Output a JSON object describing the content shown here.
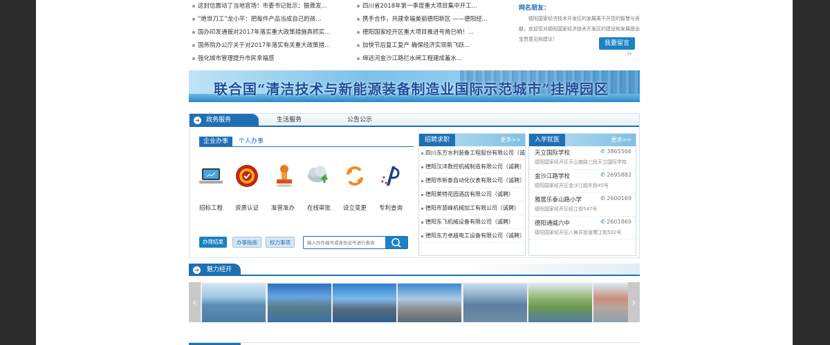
{
  "news_left": [
    "这封信震动了当地官场！市委书记批示：振聋发...",
    "“绝世刀工”龙小平：把每件产品当成自己的孩...",
    "国办印发通报对2017年落实重大政策措施真抓实...",
    "国务院办公厅关于对2017年落实有关重大政策措...",
    "强化城市管理提升市民幸福感"
  ],
  "news_right": [
    "四川省2018年第一季度重大项目集中开工...",
    "携手合作，共建幸福美丽德阳新区 ——德阳经...",
    "德阳国家经开区重大项目推进号角已响！...",
    "加快节后复工复产 确保经济实现新飞跃...",
    "绵远河金沙江路拦水闸工程建成蓄水..."
  ],
  "message": {
    "title": "网名朋友：",
    "text": "德阳国家经济技术开发区的发展离不开您的智慧与贡献，欢迎您对德阳国家经济技术开发区的建设和发展提出宝贵意见和建议！",
    "button": "我要留言"
  },
  "banner": {
    "text": "联合国“清洁技术与新能源装备制造业国际示范城市”挂牌园区"
  },
  "gov": {
    "tabs": [
      "政务服务",
      "生活服务",
      "公告公示"
    ],
    "subtabs": [
      "企业办事",
      "个人办事"
    ],
    "services": [
      {
        "label": "招标工程",
        "icon": "laptop-icon"
      },
      {
        "label": "资质认证",
        "icon": "certificate-seal-icon"
      },
      {
        "label": "准营准办",
        "icon": "stamp-icon"
      },
      {
        "label": "在线审批",
        "icon": "cloud-upload-icon"
      },
      {
        "label": "设立变更",
        "icon": "cycle-arrows-icon"
      },
      {
        "label": "专利查询",
        "icon": "patent-icon"
      }
    ],
    "buttons": [
      "办理结果",
      "办事指南",
      "权力事项"
    ],
    "search_placeholder": "输入办件编号或身份证号进行查询"
  },
  "jobs": {
    "title": "招聘求职",
    "more": "更多>>",
    "items": [
      "四川东方水利装备工程股份有限公司（诚聘）",
      "德阳汉沣数控机械制造有限公司（诚聘）",
      "德阳市新泰自动化仪表有限公司（诚聘）",
      "德阳莱特花园酒店有限公司（诚聘）",
      "德阳市慧峰机械加工有限公司（诚聘）",
      "德阳东飞机械设备有限公司（诚聘）",
      "德阳东方卓越电工设备有限公司（诚聘）"
    ]
  },
  "schools": {
    "title": "入学就医",
    "more": "更多>>",
    "items": [
      {
        "name": "天立国际学校",
        "phone": "3865566",
        "address": "德阳国家经开区天山南路三段天立国际学校"
      },
      {
        "name": "金沙江路学校",
        "phone": "2695882",
        "address": "德阳国家经开区金沙江路东段45号"
      },
      {
        "name": "雅居乐泰山路小学",
        "phone": "2600169",
        "address": "德阳国家经开区经江街547号"
      },
      {
        "name": "德阳通威六中",
        "phone": "2601869",
        "address": "德阳国家经开区八角井街道蜀江街502号"
      }
    ]
  },
  "charm": {
    "title": "魅力经开"
  },
  "gallery": {
    "prev": "‹",
    "next": "›",
    "count": 7
  },
  "colors": {
    "primary": "#1f6fb4",
    "accent": "#1b82c5",
    "background": "#2b2b2b"
  }
}
